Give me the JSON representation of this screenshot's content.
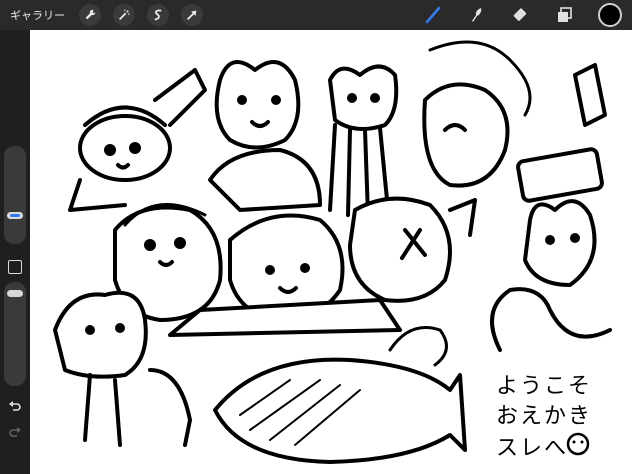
{
  "topbar": {
    "gallery_label": "ギャラリー",
    "left_tools": [
      "wrench-icon",
      "magic-wand-icon",
      "selection-s-icon",
      "arrow-transform-icon"
    ],
    "right_tools": [
      "brush-icon",
      "smudge-icon",
      "eraser-icon",
      "layers-icon"
    ],
    "active_tool": "brush-icon",
    "accent_color": "#2f7bf6",
    "current_color": "#000000"
  },
  "sidebar": {
    "brush_size_level": 0.35,
    "opacity_level": 0.05
  },
  "canvas": {
    "welcome_lines": [
      "ようこそ",
      "おえかき",
      "スレへ"
    ]
  }
}
